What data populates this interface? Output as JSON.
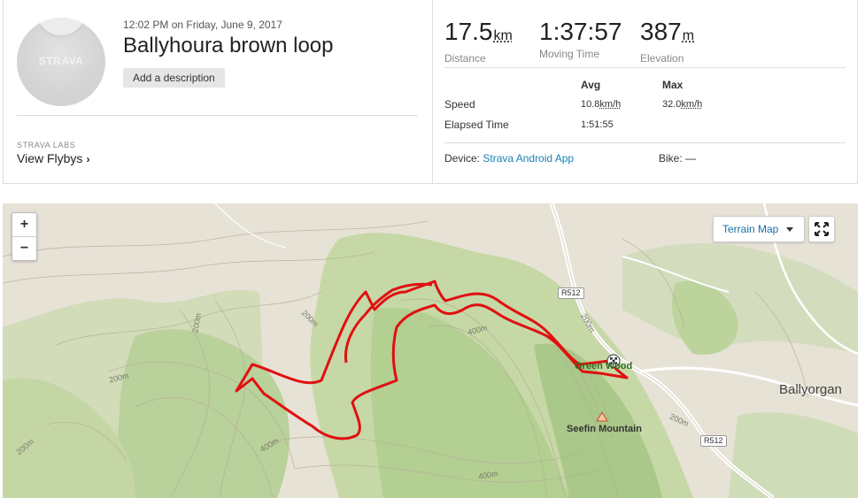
{
  "activity": {
    "datetime": "12:02 PM on Friday, June 9, 2017",
    "title": "Ballyhoura brown loop",
    "add_description_label": "Add a description",
    "avatar_logo_text": "STRAVA"
  },
  "labs": {
    "caption": "STRAVA LABS",
    "flybys_label": "View Flybys",
    "chevron": "›"
  },
  "stats": {
    "distance": {
      "value": "17.5",
      "unit": "km",
      "label": "Distance"
    },
    "moving_time": {
      "value": "1:37:57",
      "label": "Moving Time"
    },
    "elevation": {
      "value": "387",
      "unit": "m",
      "label": "Elevation"
    }
  },
  "details": {
    "header_avg": "Avg",
    "header_max": "Max",
    "speed_label": "Speed",
    "speed_avg": "10.8",
    "speed_max": "32.0",
    "speed_unit": "km/h",
    "elapsed_label": "Elapsed Time",
    "elapsed_avg": "1:51:55"
  },
  "device": {
    "label": "Device:",
    "name": "Strava Android App",
    "bike_label": "Bike:",
    "bike_value": "—"
  },
  "map": {
    "zoom_in": "+",
    "zoom_out": "−",
    "terrain_label": "Terrain Map",
    "fullscreen_icon": "expand-arrows-icon",
    "town": "Ballyorgan",
    "peak": "Seefin Mountain",
    "place_green_wood": "Green Wood",
    "roads": [
      "R512",
      "R512"
    ],
    "contours": [
      "200m",
      "200m",
      "200m",
      "200m",
      "400m",
      "200m",
      "200m",
      "400m",
      "400m"
    ],
    "route_color": "#e01010",
    "start_marker_icon": "checkered-flag-icon",
    "peak_marker_icon": "triangle-peak-icon"
  }
}
